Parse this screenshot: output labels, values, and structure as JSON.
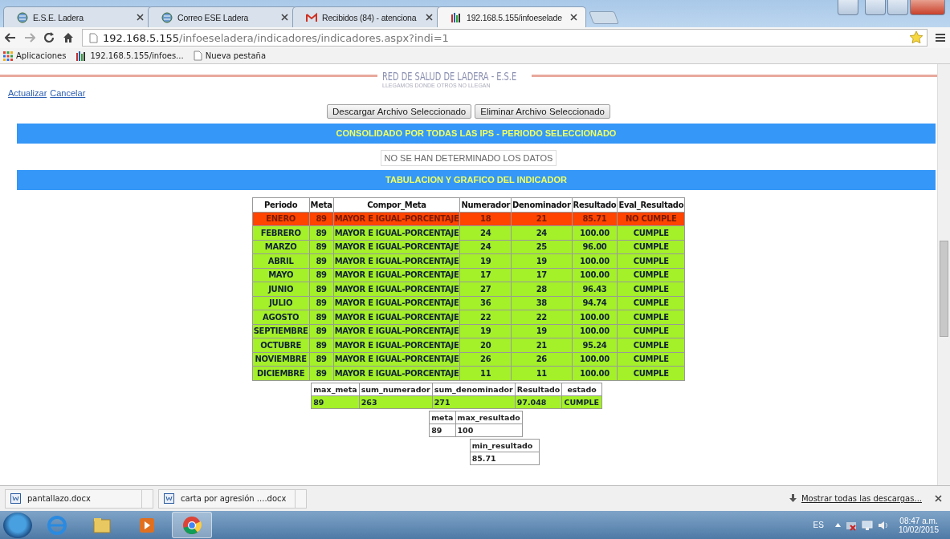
{
  "browser": {
    "tabs": [
      {
        "title": "E.S.E. Ladera",
        "selected": false
      },
      {
        "title": "Correo ESE Ladera",
        "selected": false
      },
      {
        "title": "Recibidos (84) - atenciona",
        "selected": false
      },
      {
        "title": "192.168.5.155/infoeselade",
        "selected": true
      }
    ],
    "address": {
      "host": "192.168.5.155",
      "path": "/infoeseladera/indicadores/indicadores.aspx?indi=1"
    },
    "bookmarks": [
      {
        "kind": "apps",
        "label": "Aplicaciones"
      },
      {
        "kind": "site",
        "label": "192.168.5.155/infoes..."
      },
      {
        "kind": "page",
        "label": "Nueva pestaña"
      }
    ]
  },
  "page": {
    "logo": {
      "name": "RED DE SALUD DE LADERA - E.S.E",
      "tagline": "LLEGAMOS DONDE OTROS NO LLEGAN"
    },
    "links": [
      "Actualizar",
      "Cancelar"
    ],
    "buttons": [
      "Descargar Archivo Seleccionado",
      "Eliminar Archivo Seleccionado"
    ],
    "section_1": {
      "title": "CONSOLIDADO POR TODAS LAS IPS - PERIODO SELECCIONADO",
      "message": "NO SE HAN DETERMINADO LOS DATOS"
    },
    "section_2": {
      "title": "TABULACION Y GRAFICO DEL INDICADOR"
    },
    "table": {
      "columns": [
        "Periodo",
        "Meta",
        "Compor_Meta",
        "Numerador",
        "Denominador",
        "Resultado",
        "Eval_Resultado"
      ],
      "rows": [
        {
          "met": false,
          "cells": [
            "ENERO",
            "89",
            "MAYOR E IGUAL-PORCENTAJE",
            "18",
            "21",
            "85.71",
            "NO CUMPLE"
          ]
        },
        {
          "met": true,
          "cells": [
            "FEBRERO",
            "89",
            "MAYOR E IGUAL-PORCENTAJE",
            "24",
            "24",
            "100.00",
            "CUMPLE"
          ]
        },
        {
          "met": true,
          "cells": [
            "MARZO",
            "89",
            "MAYOR E IGUAL-PORCENTAJE",
            "24",
            "25",
            "96.00",
            "CUMPLE"
          ]
        },
        {
          "met": true,
          "cells": [
            "ABRIL",
            "89",
            "MAYOR E IGUAL-PORCENTAJE",
            "19",
            "19",
            "100.00",
            "CUMPLE"
          ]
        },
        {
          "met": true,
          "cells": [
            "MAYO",
            "89",
            "MAYOR E IGUAL-PORCENTAJE",
            "17",
            "17",
            "100.00",
            "CUMPLE"
          ]
        },
        {
          "met": true,
          "cells": [
            "JUNIO",
            "89",
            "MAYOR E IGUAL-PORCENTAJE",
            "27",
            "28",
            "96.43",
            "CUMPLE"
          ]
        },
        {
          "met": true,
          "cells": [
            "JULIO",
            "89",
            "MAYOR E IGUAL-PORCENTAJE",
            "36",
            "38",
            "94.74",
            "CUMPLE"
          ]
        },
        {
          "met": true,
          "cells": [
            "AGOSTO",
            "89",
            "MAYOR E IGUAL-PORCENTAJE",
            "22",
            "22",
            "100.00",
            "CUMPLE"
          ]
        },
        {
          "met": true,
          "cells": [
            "SEPTIEMBRE",
            "89",
            "MAYOR E IGUAL-PORCENTAJE",
            "19",
            "19",
            "100.00",
            "CUMPLE"
          ]
        },
        {
          "met": true,
          "cells": [
            "OCTUBRE",
            "89",
            "MAYOR E IGUAL-PORCENTAJE",
            "20",
            "21",
            "95.24",
            "CUMPLE"
          ]
        },
        {
          "met": true,
          "cells": [
            "NOVIEMBRE",
            "89",
            "MAYOR E IGUAL-PORCENTAJE",
            "26",
            "26",
            "100.00",
            "CUMPLE"
          ]
        },
        {
          "met": true,
          "cells": [
            "DICIEMBRE",
            "89",
            "MAYOR E IGUAL-PORCENTAJE",
            "11",
            "11",
            "100.00",
            "CUMPLE"
          ]
        }
      ]
    },
    "summaries": [
      {
        "columns": [
          "max_meta",
          "sum_numerador",
          "sum_denominador",
          "Resultado",
          "estado"
        ],
        "rows": [
          {
            "met": true,
            "cells": [
              "89",
              "263",
              "271",
              "97.048",
              "CUMPLE"
            ]
          }
        ]
      },
      {
        "columns": [
          "meta",
          "max_resultado"
        ],
        "rows": [
          {
            "met": null,
            "cells": [
              "89",
              "100"
            ]
          }
        ]
      },
      {
        "columns": [
          "min_resultado"
        ],
        "rows": [
          {
            "met": null,
            "cells": [
              "85.71"
            ]
          }
        ]
      }
    ]
  },
  "downloads": {
    "items": [
      "pantallazo.docx",
      "carta por agresión ....docx"
    ],
    "show_all": "Mostrar todas las descargas..."
  },
  "taskbar": {
    "language": "ES",
    "time": "08:47 a.m.",
    "date": "10/02/2015"
  }
}
